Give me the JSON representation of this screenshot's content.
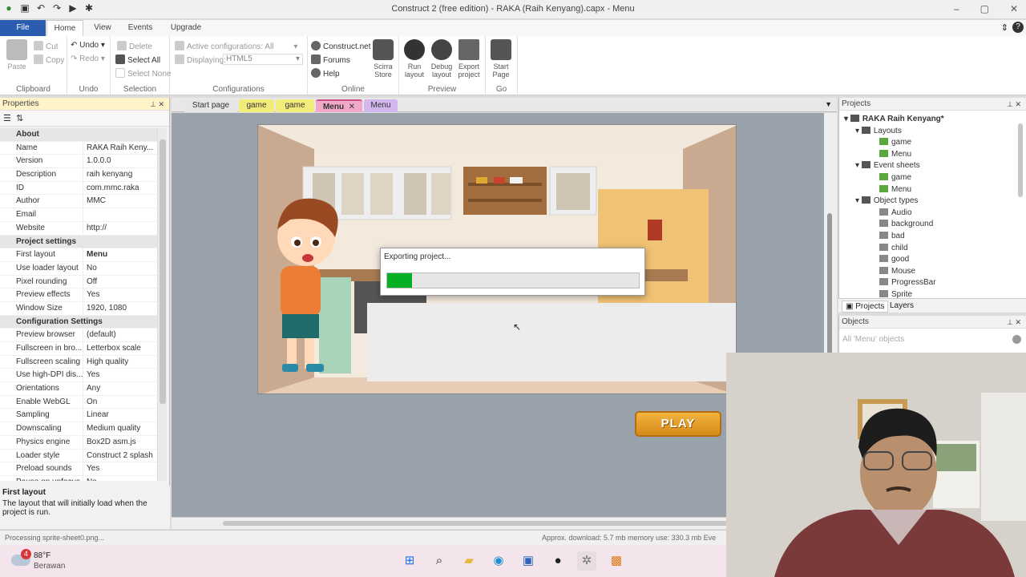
{
  "window": {
    "title": "Construct 2  (free edition) - RAKA (Raih Kenyang).capx - Menu"
  },
  "menu_tabs": [
    "File",
    "Home",
    "View",
    "Events",
    "Upgrade"
  ],
  "ribbon": {
    "clipboard": {
      "label": "Clipboard",
      "paste": "Paste",
      "cut": "Cut",
      "copy": "Copy"
    },
    "undo": {
      "label": "Undo",
      "undo": "Undo",
      "redo": "Redo"
    },
    "selection": {
      "label": "Selection",
      "delete": "Delete",
      "select_all": "Select All",
      "select_none": "Select None"
    },
    "configurations": {
      "label": "Configurations",
      "active": "Active configurations: All",
      "displaying": "Displaying:",
      "displaying_value": "HTML5"
    },
    "online": {
      "label": "Online",
      "construct_net": "Construct.net",
      "forums": "Forums",
      "help": "Help",
      "scirra_store": "Scirra Store"
    },
    "preview": {
      "label": "Preview",
      "run_layout": "Run layout",
      "debug_layout": "Debug layout",
      "export_project": "Export project"
    },
    "go": {
      "label": "Go",
      "start_page": "Start Page"
    }
  },
  "properties": {
    "title": "Properties",
    "rows": [
      {
        "section": "About"
      },
      {
        "k": "Name",
        "v": "RAKA  Raih Keny..."
      },
      {
        "k": "Version",
        "v": "1.0.0.0"
      },
      {
        "k": "Description",
        "v": "raih kenyang"
      },
      {
        "k": "ID",
        "v": "com.mmc.raka"
      },
      {
        "k": "Author",
        "v": "MMC"
      },
      {
        "k": "Email",
        "v": ""
      },
      {
        "k": "Website",
        "v": "http://"
      },
      {
        "section": "Project settings"
      },
      {
        "k": "First layout",
        "v": "Menu",
        "selected": true
      },
      {
        "k": "Use loader layout",
        "v": "No"
      },
      {
        "k": "Pixel rounding",
        "v": "Off"
      },
      {
        "k": "Preview effects",
        "v": "Yes"
      },
      {
        "k": "Window Size",
        "v": "1920, 1080"
      },
      {
        "section": "Configuration Settings"
      },
      {
        "k": "Preview browser",
        "v": "(default)"
      },
      {
        "k": "Fullscreen in bro...",
        "v": "Letterbox scale"
      },
      {
        "k": "Fullscreen scaling",
        "v": "High quality"
      },
      {
        "k": "Use high-DPI dis...",
        "v": "Yes"
      },
      {
        "k": "Orientations",
        "v": "Any"
      },
      {
        "k": "Enable WebGL",
        "v": "On"
      },
      {
        "k": "Sampling",
        "v": "Linear"
      },
      {
        "k": "Downscaling",
        "v": "Medium quality"
      },
      {
        "k": "Physics engine",
        "v": "Box2D asm.js"
      },
      {
        "k": "Loader style",
        "v": "Construct 2 splash"
      },
      {
        "k": "Preload sounds",
        "v": "Yes"
      },
      {
        "k": "Pause on unfocus",
        "v": "No"
      }
    ],
    "desc_title": "First layout",
    "desc_text": "The layout that will initially load when the project is run."
  },
  "doc_tabs": [
    {
      "label": "Start page",
      "color": "#e6e6e6"
    },
    {
      "label": "game",
      "color": "#f2ec7a"
    },
    {
      "label": "game",
      "color": "#f2ec7a"
    },
    {
      "label": "Menu",
      "color": "#f2a8c8",
      "active": true
    },
    {
      "label": "Menu",
      "color": "#d2b6ee"
    }
  ],
  "layout": {
    "play_button": "PLAY"
  },
  "export_dialog": {
    "title": "Exporting project...",
    "progress": 0.1
  },
  "projects": {
    "title": "Projects",
    "tree": [
      {
        "label": "RAKA  Raih Kenyang*",
        "level": 0,
        "bold": true,
        "type": "folder"
      },
      {
        "label": "Layouts",
        "level": 1,
        "type": "folder"
      },
      {
        "label": "game",
        "level": 2,
        "type": "layout"
      },
      {
        "label": "Menu",
        "level": 2,
        "type": "layout"
      },
      {
        "label": "Event sheets",
        "level": 1,
        "type": "folder"
      },
      {
        "label": "game",
        "level": 2,
        "type": "sheet"
      },
      {
        "label": "Menu",
        "level": 2,
        "type": "sheet"
      },
      {
        "label": "Object types",
        "level": 1,
        "type": "folder"
      },
      {
        "label": "Audio",
        "level": 2,
        "type": "obj"
      },
      {
        "label": "background",
        "level": 2,
        "type": "obj"
      },
      {
        "label": "bad",
        "level": 2,
        "type": "obj"
      },
      {
        "label": "child",
        "level": 2,
        "type": "obj"
      },
      {
        "label": "good",
        "level": 2,
        "type": "obj"
      },
      {
        "label": "Mouse",
        "level": 2,
        "type": "obj"
      },
      {
        "label": "ProgressBar",
        "level": 2,
        "type": "obj"
      },
      {
        "label": "Sprite",
        "level": 2,
        "type": "obj"
      }
    ],
    "tab_projects": "Projects",
    "tab_layers": "Layers"
  },
  "objects": {
    "title": "Objects",
    "filter": "All 'Menu' objects"
  },
  "status": {
    "left": "Processing sprite-sheet0.png...",
    "right": "Approx. download: 5.7 mb  memory use: 330.3 mb  Eve"
  },
  "taskbar": {
    "weather_temp": "88°F",
    "weather_desc": "Berawan",
    "badge": "4"
  }
}
